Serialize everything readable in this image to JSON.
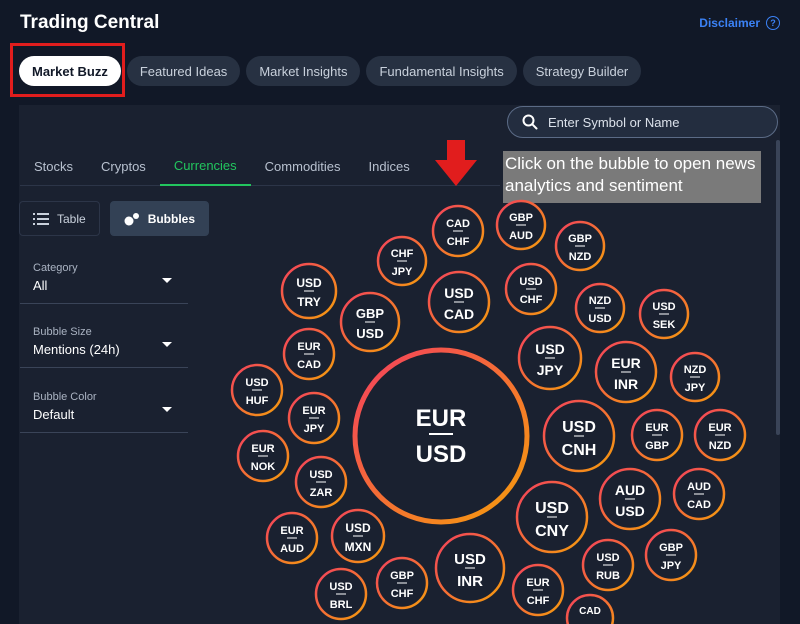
{
  "header": {
    "title": "Trading Central",
    "disclaimer": "Disclaimer"
  },
  "top_tabs": [
    "Market Buzz",
    "Featured Ideas",
    "Market Insights",
    "Fundamental Insights",
    "Strategy Builder"
  ],
  "search": {
    "placeholder": "Enter Symbol or Name"
  },
  "sub_tabs": [
    "Stocks",
    "Cryptos",
    "Currencies",
    "Commodities",
    "Indices"
  ],
  "instruction": "Click on the bubble to open news analytics and sentiment",
  "view_toggle": {
    "table": "Table",
    "bubbles": "Bubbles"
  },
  "controls": {
    "category": {
      "label": "Category",
      "value": "All"
    },
    "bubble_size": {
      "label": "Bubble Size",
      "value": "Mentions (24h)"
    },
    "bubble_color": {
      "label": "Bubble Color",
      "value": "Default"
    }
  },
  "bubbles": [
    {
      "top": "EUR",
      "bottom": "USD"
    },
    {
      "top": "CAD",
      "bottom": "CHF"
    },
    {
      "top": "GBP",
      "bottom": "AUD"
    },
    {
      "top": "GBP",
      "bottom": "NZD"
    },
    {
      "top": "CHF",
      "bottom": "JPY"
    },
    {
      "top": "USD",
      "bottom": "TRY"
    },
    {
      "top": "GBP",
      "bottom": "USD"
    },
    {
      "top": "USD",
      "bottom": "CAD"
    },
    {
      "top": "USD",
      "bottom": "CHF"
    },
    {
      "top": "NZD",
      "bottom": "USD"
    },
    {
      "top": "USD",
      "bottom": "SEK"
    },
    {
      "top": "EUR",
      "bottom": "CAD"
    },
    {
      "top": "USD",
      "bottom": "JPY"
    },
    {
      "top": "EUR",
      "bottom": "INR"
    },
    {
      "top": "NZD",
      "bottom": "JPY"
    },
    {
      "top": "USD",
      "bottom": "HUF"
    },
    {
      "top": "EUR",
      "bottom": "JPY"
    },
    {
      "top": "USD",
      "bottom": "CNH"
    },
    {
      "top": "EUR",
      "bottom": "GBP"
    },
    {
      "top": "EUR",
      "bottom": "NZD"
    },
    {
      "top": "EUR",
      "bottom": "NOK"
    },
    {
      "top": "USD",
      "bottom": "ZAR"
    },
    {
      "top": "AUD",
      "bottom": "USD"
    },
    {
      "top": "AUD",
      "bottom": "CAD"
    },
    {
      "top": "USD",
      "bottom": "CNY"
    },
    {
      "top": "EUR",
      "bottom": "AUD"
    },
    {
      "top": "USD",
      "bottom": "MXN"
    },
    {
      "top": "GBP",
      "bottom": "JPY"
    },
    {
      "top": "USD",
      "bottom": "INR"
    },
    {
      "top": "USD",
      "bottom": "RUB"
    },
    {
      "top": "GBP",
      "bottom": "CHF"
    },
    {
      "top": "USD",
      "bottom": "BRL"
    },
    {
      "top": "EUR",
      "bottom": "CHF"
    },
    {
      "top": "CAD",
      "bottom": ""
    }
  ]
}
